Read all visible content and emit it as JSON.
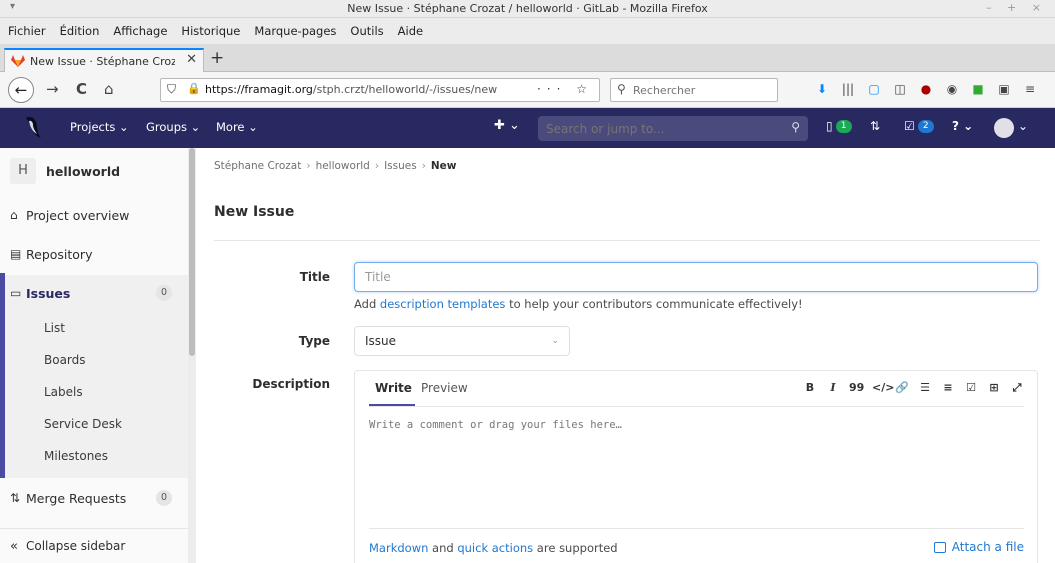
{
  "window": {
    "title": "New Issue · Stéphane Crozat / helloworld · GitLab - Mozilla Firefox",
    "wm_menu": "▾",
    "wm_buttons": "– + ×"
  },
  "menu": [
    {
      "label": "Fichier"
    },
    {
      "label": "Édition"
    },
    {
      "label": "Affichage"
    },
    {
      "label": "Historique"
    },
    {
      "label": "Marque-pages"
    },
    {
      "label": "Outils"
    },
    {
      "label": "Aide"
    }
  ],
  "tab": {
    "title": "New Issue · Stéphane Crozat",
    "close": "✕",
    "new_tab": "+"
  },
  "nav": {
    "back": "←",
    "forward": "→",
    "reload": "C",
    "home": "⌂",
    "url_host": "https://framagit.org",
    "url_path": "/stph.crzt/helloworld/-/issues/new",
    "page_actions": "··· ☆",
    "search_placeholder": "Rechercher",
    "toolbar_icons": [
      "⬇",
      "|||",
      "▢",
      "◫",
      "●",
      "◉",
      "■",
      "▣",
      "≡"
    ]
  },
  "gitlab": {
    "projects": "Projects ⌄",
    "groups": "Groups ⌄",
    "more": "More ⌄",
    "plus": "✚ ⌄",
    "search_placeholder": "Search or jump to...",
    "todo_count": "1",
    "mr_icon": "⇅",
    "issues_count": "2",
    "help": "? ⌄",
    "user_caret": "⌄"
  },
  "sidebar": {
    "project_initial": "H",
    "project_name": "helloworld",
    "items": [
      {
        "label": "Project overview",
        "icon": "⌂"
      },
      {
        "label": "Repository",
        "icon": "▤"
      },
      {
        "label": "Issues",
        "icon": "▭",
        "count": "0"
      },
      {
        "label": "Merge Requests",
        "icon": "⇅",
        "count": "0"
      }
    ],
    "sub_items": [
      {
        "label": "List"
      },
      {
        "label": "Boards"
      },
      {
        "label": "Labels"
      },
      {
        "label": "Service Desk"
      },
      {
        "label": "Milestones"
      }
    ],
    "collapse": "Collapse sidebar",
    "collapse_icon": "«"
  },
  "breadcrumb": {
    "owner": "Stéphane Crozat",
    "project": "helloworld",
    "section": "Issues",
    "current": "New",
    "sep": "›"
  },
  "form": {
    "page_title": "New Issue",
    "title_label": "Title",
    "title_placeholder": "Title",
    "help_prefix": "Add ",
    "help_link": "description templates",
    "help_suffix": " to help your contributors communicate effectively!",
    "type_label": "Type",
    "type_value": "Issue",
    "type_chevron": "⌄",
    "description_label": "Description",
    "tab_write": "Write",
    "tab_preview": "Preview",
    "md_tools": [
      "B",
      "I",
      "99",
      "</>",
      "🔗",
      "☰",
      "≡",
      "☑",
      "⊞",
      "⤢"
    ],
    "desc_placeholder": "Write a comment or drag your files here…",
    "footer_markdown": "Markdown",
    "footer_and": " and ",
    "footer_quick": "quick actions",
    "footer_suffix": " are supported",
    "attach": "Attach a file"
  },
  "colors": {
    "header_bg": "#292961",
    "accent": "#4b4ba3",
    "link": "#1f78d1",
    "badge_green": "#1aaa55"
  }
}
